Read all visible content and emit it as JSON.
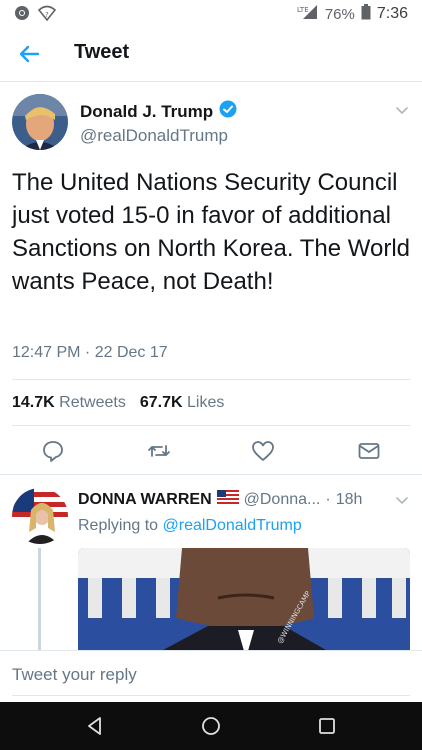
{
  "status_bar": {
    "network": "LTE",
    "battery": "76%",
    "time": "7:36"
  },
  "header": {
    "title": "Tweet",
    "back_icon": "arrow-left-icon"
  },
  "tweet": {
    "author_name": "Donald J. Trump",
    "author_handle": "@realDonaldTrump",
    "verified": true,
    "text": "The United Nations Security Council just voted 15-0 in favor of additional Sanctions on North Korea. The World wants Peace, not Death!",
    "timestamp": "12:47 PM · 22 Dec 17",
    "retweets_count": "14.7K",
    "retweets_label": "Retweets",
    "likes_count": "67.7K",
    "likes_label": "Likes"
  },
  "reply": {
    "author_name": "DONNA WARREN",
    "author_handle": "@Donna...",
    "time_sep": "·",
    "time": "18h",
    "replying_label": "Replying to",
    "replying_to": "@realDonaldTrump",
    "media_watermark": "@WINNINGCAMP"
  },
  "composer": {
    "placeholder": "Tweet your reply"
  },
  "colors": {
    "accent": "#1da1f2",
    "text": "#14171a",
    "muted": "#657786",
    "border": "#e1e8ed"
  }
}
